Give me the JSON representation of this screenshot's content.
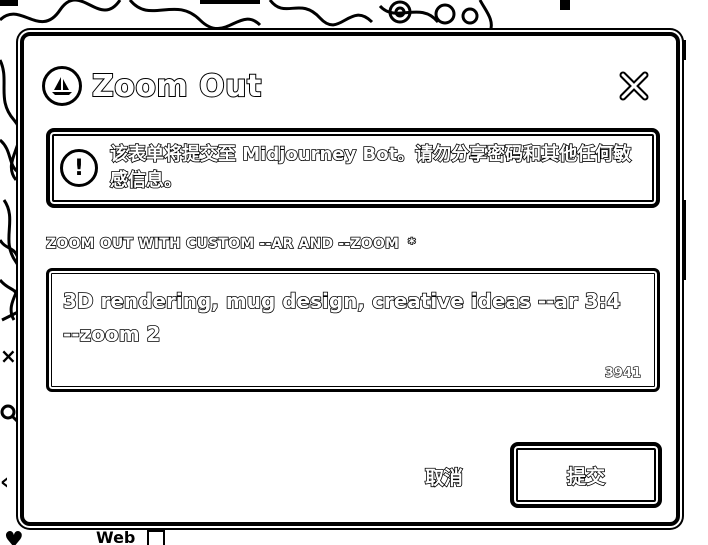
{
  "background": {
    "web_link_label": "Web"
  },
  "dialog": {
    "title": "Zoom Out",
    "alert_text": "该表单将提交至 Midjourney Bot。请勿分享密码和其他任何敏感信息。",
    "field_label": "ZOOM OUT WITH CUSTOM --AR AND --ZOOM",
    "required_marker": "*",
    "field_value": " 3D rendering, mug design, creative ideas --ar 3:4 --zoom 2",
    "char_counter": "3941",
    "cancel_label": "取消",
    "submit_label": "提交"
  },
  "icons": {
    "app": "midjourney-boat-icon",
    "close": "close-icon",
    "alert": "exclamation-circle-icon",
    "external": "external-link-icon"
  },
  "colors": {
    "ink": "#000000",
    "paper": "#ffffff"
  }
}
